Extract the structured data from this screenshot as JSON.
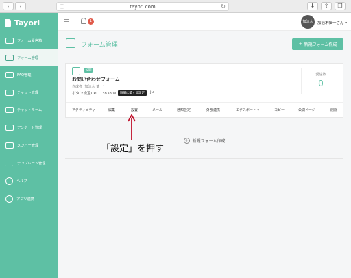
{
  "browser": {
    "url": "tayori.com",
    "back_label": "‹",
    "forward_label": "›",
    "download_icon": "download-icon",
    "share_icon": "share-icon",
    "tabs_icon": "tabs-icon"
  },
  "app": {
    "name": "Tayori",
    "accent": "#5ec0a4"
  },
  "sidebar": {
    "items": [
      {
        "label": "フォーム受信箱",
        "icon": "inbox-icon"
      },
      {
        "label": "フォーム管理",
        "icon": "edit-icon"
      },
      {
        "label": "FAQ管理",
        "icon": "faq-icon"
      },
      {
        "label": "チャット管理",
        "icon": "chat-icon"
      },
      {
        "label": "チャットルーム",
        "icon": "chatroom-icon"
      },
      {
        "label": "アンケート管理",
        "icon": "survey-icon"
      },
      {
        "label": "メンバー管理",
        "icon": "members-icon"
      },
      {
        "label": "テンプレート管理",
        "icon": "template-icon"
      },
      {
        "label": "ヘルプ",
        "icon": "help-icon"
      },
      {
        "label": "アプリ連携",
        "icon": "plus-icon"
      }
    ]
  },
  "topbar": {
    "notification_count": "1",
    "avatar_text": "加治木",
    "username": "加治木慎一さん ▾"
  },
  "page": {
    "title": "フォーム管理",
    "new_form_button": "新規フォーム作成",
    "new_form_plus": "+"
  },
  "card": {
    "badge": "公開",
    "title": "お問い合わせフォーム",
    "author": "作成者 [加治木 慎一]",
    "url_label": "ボタン設置URL：3838.w",
    "url_tail": "ju",
    "tooltip": "詳細に関する設定",
    "count_label": "受信数",
    "count_value": "0",
    "actions": {
      "activity": "アクティビティ",
      "edit": "編集",
      "settings": "設置",
      "mail": "メール",
      "notify": "通知設定",
      "external": "外部連携",
      "export": "エクスポート ▾",
      "copy": "コピー",
      "public_page": "公開ページ",
      "delete": "削除"
    }
  },
  "new_area": {
    "label": "新規フォーム作成",
    "plus": "+"
  },
  "annotation": {
    "text": "「設定」を押す",
    "color": "#c0102a"
  }
}
